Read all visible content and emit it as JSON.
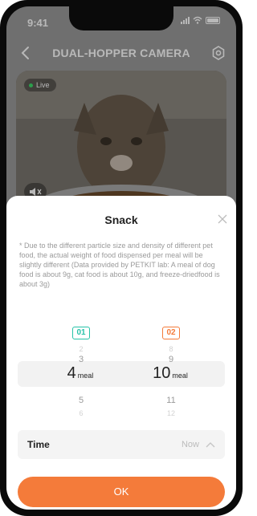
{
  "status_bar": {
    "time": "9:41"
  },
  "header": {
    "title": "DUAL-HOPPER CAMERA"
  },
  "video": {
    "live_label": "Live"
  },
  "sheet": {
    "title": "Snack",
    "note": "* Due to the different particle size and density of different pet food, the actual weight of food dispensed per meal will be slightly different (Data provided by PETKIT lab: A meal of dog food is about 9g, cat food is about 10g, and freeze-driedfood is about 3g)",
    "columns": [
      {
        "badge": "01",
        "above_far": "2",
        "above": "3",
        "selected": "4",
        "unit": "meal",
        "below": "5",
        "below_far": "6"
      },
      {
        "badge": "02",
        "above_far": "8",
        "above": "9",
        "selected": "10",
        "unit": "meal",
        "below": "11",
        "below_far": "12"
      }
    ],
    "time": {
      "label": "Time",
      "value": "Now"
    },
    "ok_label": "OK"
  },
  "colors": {
    "accent": "#f47b3a",
    "teal": "#27c2a8"
  },
  "icons": [
    "back-icon",
    "settings-icon",
    "mute-icon",
    "close-icon",
    "chevron-up-icon"
  ]
}
